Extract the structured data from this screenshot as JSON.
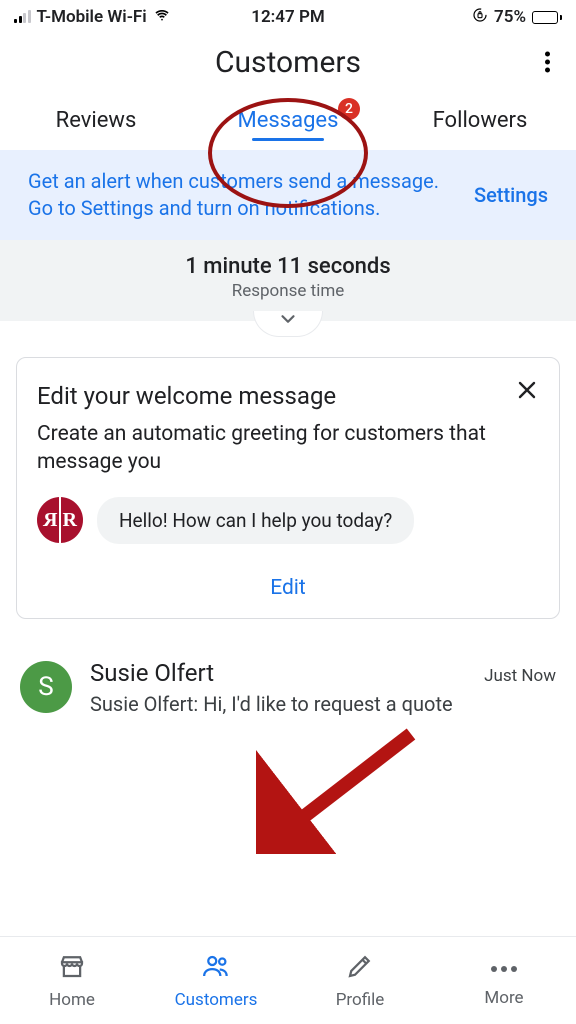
{
  "status_bar": {
    "carrier": "T-Mobile Wi-Fi",
    "time": "12:47 PM",
    "battery_pct": "75%"
  },
  "header": {
    "title": "Customers"
  },
  "tabs": {
    "reviews": "Reviews",
    "messages": "Messages",
    "followers": "Followers",
    "badge_count": "2"
  },
  "banner": {
    "text": "Get an alert when customers send a message. Go to Settings and turn on notifications.",
    "action": "Settings"
  },
  "response": {
    "value": "1 minute 11 seconds",
    "label": "Response time"
  },
  "welcome_card": {
    "title": "Edit your welcome message",
    "subtitle": "Create an automatic greeting for customers that message you",
    "bubble": "Hello! How can I help you today?",
    "edit": "Edit"
  },
  "conversation": {
    "avatar_initial": "S",
    "name": "Susie Olfert",
    "time": "Just Now",
    "preview": "Susie Olfert: Hi, I'd like to request a quote"
  },
  "bottom_nav": {
    "home": "Home",
    "customers": "Customers",
    "profile": "Profile",
    "more": "More"
  }
}
